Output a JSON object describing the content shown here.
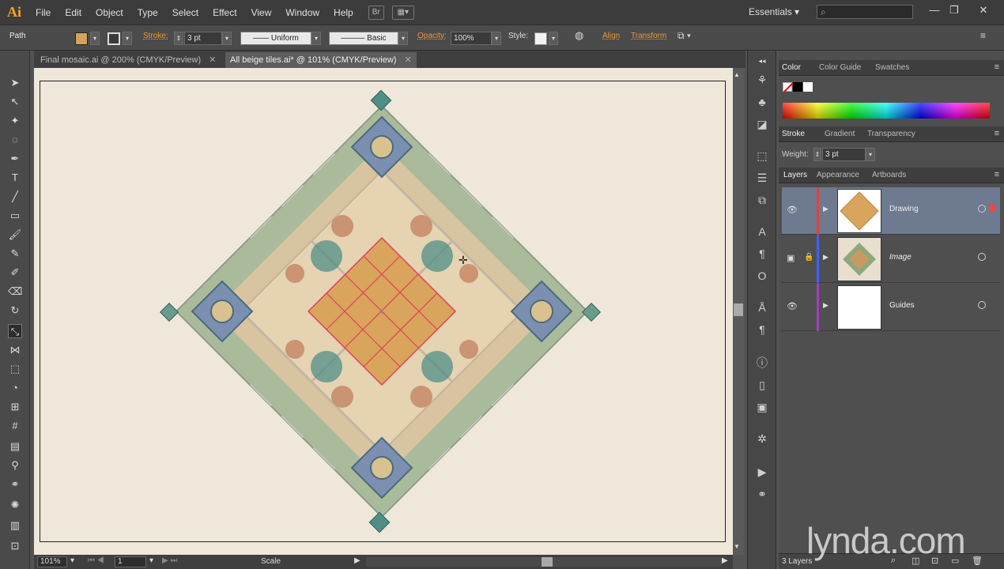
{
  "app": {
    "logo": "Ai"
  },
  "menu": [
    "File",
    "Edit",
    "Object",
    "Type",
    "Select",
    "Effect",
    "View",
    "Window",
    "Help"
  ],
  "workspace": {
    "label": "Essentials"
  },
  "window_buttons": {
    "minimize": "—",
    "restore": "❐",
    "close": "✕"
  },
  "control_bar": {
    "selection_type": "Path",
    "fill_color": "#d6a15b",
    "stroke_label": "Stroke:",
    "stroke_weight": "3 pt",
    "variable_width": "Uniform",
    "brush": "Basic",
    "opacity_label": "Opacity:",
    "opacity": "100%",
    "style_label": "Style:",
    "align_label": "Align",
    "transform_label": "Transform"
  },
  "documents": [
    {
      "title": "Final mosaic.ai @ 200% (CMYK/Preview)",
      "active": false
    },
    {
      "title": "All beige tiles.ai* @ 101% (CMYK/Preview)",
      "active": true
    }
  ],
  "status_bar": {
    "zoom": "101%",
    "artboard": "1",
    "tool_status": "Scale"
  },
  "color_panel": {
    "tabs": [
      "Color",
      "Color Guide",
      "Swatches"
    ]
  },
  "stroke_panel": {
    "tabs": [
      "Stroke",
      "Gradient",
      "Transparency"
    ],
    "weight_label": "Weight:",
    "weight": "3 pt"
  },
  "layers_panel": {
    "tabs": [
      "Layers",
      "Appearance",
      "Artboards"
    ],
    "layers": [
      {
        "name": "Drawing",
        "color": "#e04040",
        "selected": true
      },
      {
        "name": "Image",
        "color": "#4060ff",
        "selected": false
      },
      {
        "name": "Guides",
        "color": "#a040c0",
        "selected": false
      }
    ],
    "count": "3 Layers"
  },
  "watermark": "lynda.com",
  "colors": {
    "accent": "#e79a3a",
    "tile_fill": "#d9a55c",
    "tile_line": "#e0405a",
    "canvas_bg": "#efe7da"
  }
}
